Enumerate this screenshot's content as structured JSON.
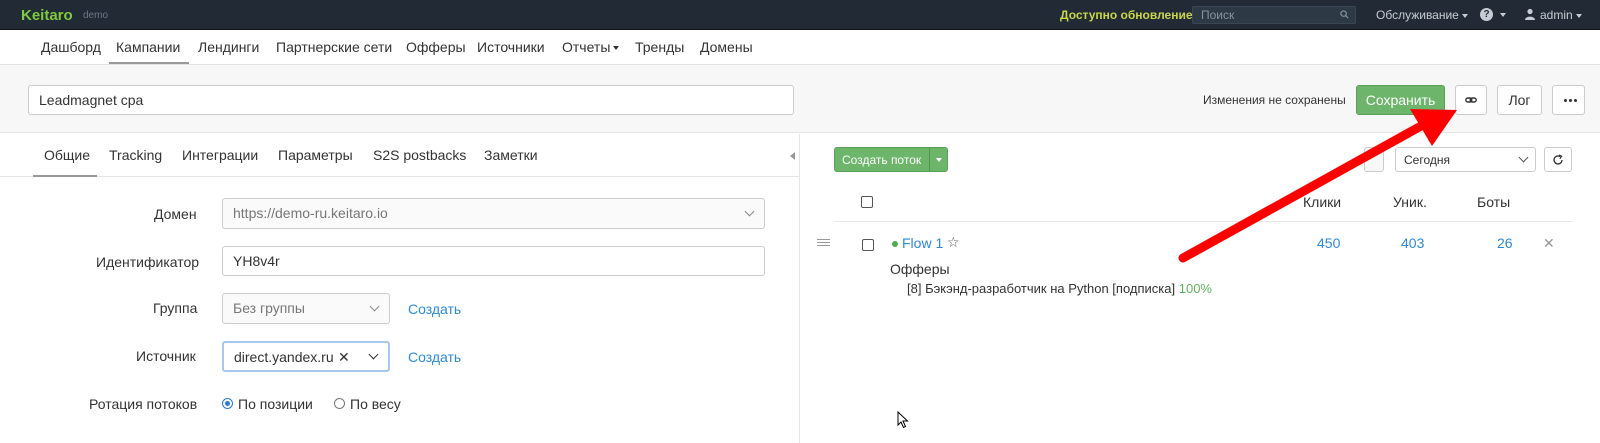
{
  "topbar": {
    "logo": "Keitaro",
    "logo_sub": "demo",
    "update_notice": "Доступно обновление!",
    "search_placeholder": "Поиск",
    "service_menu": "Обслуживание",
    "help_label": "?",
    "user": "admin"
  },
  "nav": {
    "items": [
      "Дашборд",
      "Кампании",
      "Лендинги",
      "Партнерские сети",
      "Офферы",
      "Источники",
      "Отчеты",
      "Тренды",
      "Домены"
    ],
    "active": "Кампании"
  },
  "campaign": {
    "name": "Leadmagnet cpa",
    "unsaved_notice": "Изменения не сохранены",
    "save_label": "Сохранить",
    "log_label": "Лог"
  },
  "tabs": {
    "items": [
      "Общие",
      "Tracking",
      "Интеграции",
      "Параметры",
      "S2S postbacks",
      "Заметки"
    ],
    "active": "Общие"
  },
  "form": {
    "domain_label": "Домен",
    "domain_value": "https://demo-ru.keitaro.io",
    "id_label": "Идентификатор",
    "id_value": "YH8v4r",
    "group_label": "Группа",
    "group_value": "Без группы",
    "group_create": "Создать",
    "source_label": "Источник",
    "source_value": "direct.yandex.ru",
    "source_create": "Создать",
    "rotation_label": "Ротация потоков",
    "rotation_options": [
      "По позиции",
      "По весу"
    ],
    "rotation_selected": "По позиции"
  },
  "flows": {
    "create_label": "Создать поток",
    "period": "Сегодня",
    "columns": [
      "Клики",
      "Уник.",
      "Боты"
    ],
    "rows": [
      {
        "name": "Flow 1",
        "clicks": "450",
        "unique": "403",
        "bots": "26",
        "offers_label": "Офферы",
        "offer": "[8] Бэкэнд-разработчик на Python [подписка]",
        "offer_share": "100%"
      }
    ]
  },
  "colors": {
    "accent_green": "#6cb56a",
    "link_blue": "#2a8ad8",
    "annotation_red": "#ff0000",
    "topbar_bg": "#222b35"
  }
}
